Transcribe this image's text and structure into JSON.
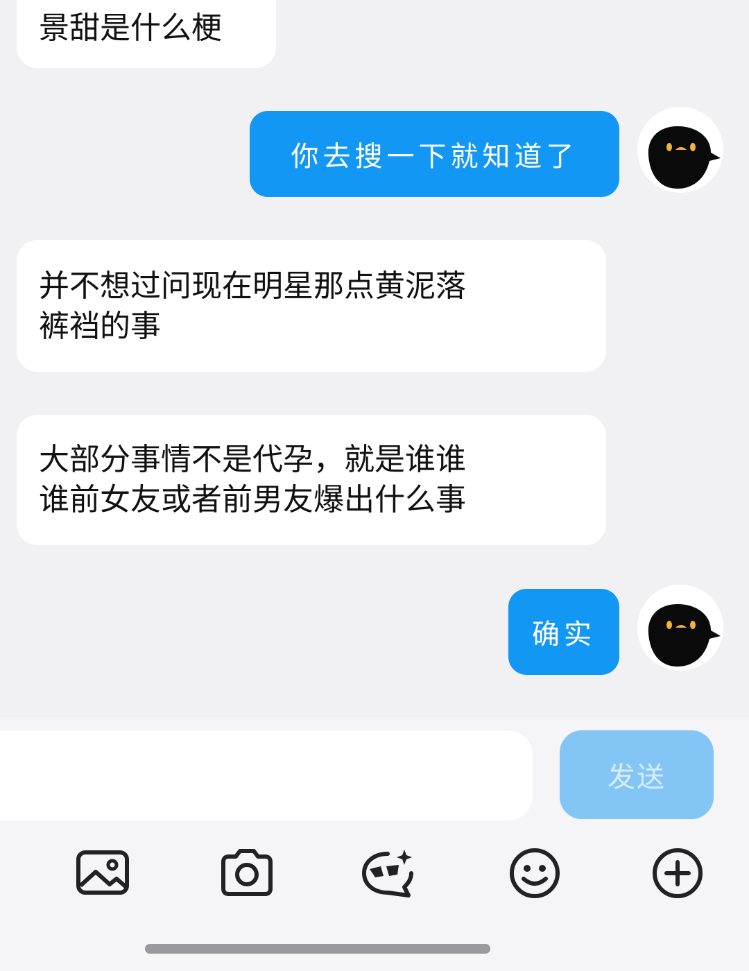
{
  "messages": [
    {
      "side": "in",
      "text": "景甜是什么梗"
    },
    {
      "side": "out",
      "text": "你去搜一下就知道了"
    },
    {
      "side": "in",
      "lines": [
        "并不想过问现在明星那点黄泥落",
        "裤裆的事"
      ]
    },
    {
      "side": "in",
      "lines": [
        "大部分事情不是代孕，就是谁谁",
        "谁前女友或者前男友爆出什么事"
      ]
    },
    {
      "side": "out",
      "text": "确实"
    }
  ],
  "composer": {
    "input_value": "",
    "send_label": "发送"
  },
  "toolbar": {
    "icons": [
      "image-icon",
      "camera-icon",
      "ai-sticker-icon",
      "emoji-icon",
      "plus-icon"
    ]
  },
  "colors": {
    "outgoing_bubble": "#1297f5",
    "incoming_bubble": "#ffffff",
    "send_button": "#83c6f6",
    "background": "#f1f1f4"
  }
}
